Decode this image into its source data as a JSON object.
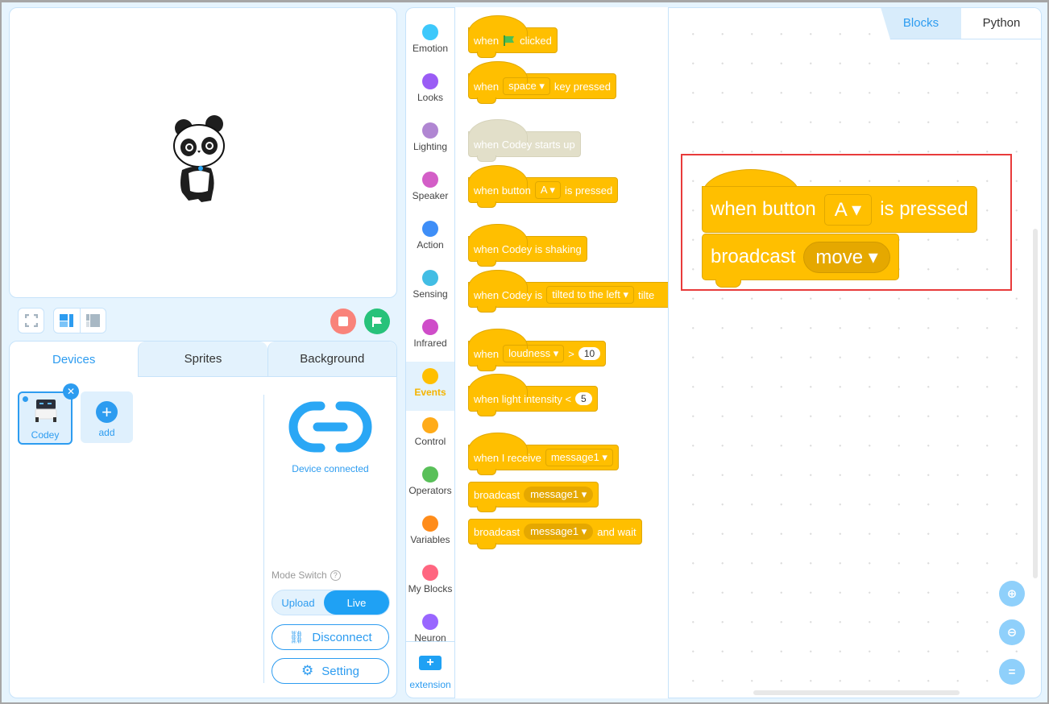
{
  "stage": {
    "sprite": "panda-sprite",
    "controls": {
      "fullscreen_icon": "fullscreen-icon",
      "layout_normal_icon": "layout-normal-icon",
      "layout_small_icon": "layout-small-icon",
      "stop_icon": "stop-icon",
      "go_icon": "green-flag-icon"
    }
  },
  "device_panel": {
    "tabs": [
      {
        "label": "Devices",
        "active": true
      },
      {
        "label": "Sprites",
        "active": false
      },
      {
        "label": "Background",
        "active": false
      }
    ],
    "devices": [
      {
        "label": "Codey",
        "selected": true
      }
    ],
    "add_label": "add",
    "connection_status": "Device connected",
    "mode_switch_label": "Mode Switch",
    "modes": [
      {
        "label": "Upload",
        "active": false
      },
      {
        "label": "Live",
        "active": true
      }
    ],
    "disconnect_label": "Disconnect",
    "setting_label": "Setting"
  },
  "categories": [
    {
      "label": "Emotion",
      "color": "#3dc8fb"
    },
    {
      "label": "Looks",
      "color": "#9a5cf5"
    },
    {
      "label": "Lighting",
      "color": "#b086d2"
    },
    {
      "label": "Speaker",
      "color": "#d35ec7"
    },
    {
      "label": "Action",
      "color": "#3e8ef7"
    },
    {
      "label": "Sensing",
      "color": "#42bde4"
    },
    {
      "label": "Infrared",
      "color": "#cf4dc9"
    },
    {
      "label": "Events",
      "color": "#ffbf00",
      "active": true
    },
    {
      "label": "Control",
      "color": "#ffab19"
    },
    {
      "label": "Operators",
      "color": "#59c059"
    },
    {
      "label": "Variables",
      "color": "#ff8c1a"
    },
    {
      "label": "My Blocks",
      "color": "#ff6680"
    },
    {
      "label": "Neuron",
      "color": "#9966ff"
    }
  ],
  "extension_label": "extension",
  "palette_blocks": {
    "b1": {
      "when": "when",
      "clicked": "clicked"
    },
    "b2": {
      "when": "when",
      "key": "space",
      "rest": "key pressed"
    },
    "b3": {
      "text": "when Codey starts up"
    },
    "b4": {
      "text": "when button",
      "value": "A",
      "rest": "is pressed"
    },
    "b5": {
      "text": "when Codey is shaking"
    },
    "b6": {
      "text": "when Codey is",
      "value": "tilted to the left",
      "rest": "tilte"
    },
    "b7": {
      "when": "when",
      "value": "loudness",
      "op": ">",
      "num": "10"
    },
    "b8": {
      "text": "when light intensity <",
      "num": "5"
    },
    "b9": {
      "text": "when I receive",
      "value": "message1"
    },
    "b10": {
      "text": "broadcast",
      "value": "message1"
    },
    "b11": {
      "text": "broadcast",
      "value": "message1",
      "rest": "and wait"
    }
  },
  "code_tabs": [
    {
      "label": "Blocks",
      "active": true
    },
    {
      "label": "Python",
      "active": false
    }
  ],
  "script": {
    "hat": {
      "text": "when button",
      "value": "A",
      "rest": "is pressed"
    },
    "stack": {
      "text": "broadcast",
      "value": "move"
    }
  },
  "zoom_controls": [
    "zoom-in-icon",
    "zoom-out-icon",
    "zoom-reset-icon"
  ]
}
